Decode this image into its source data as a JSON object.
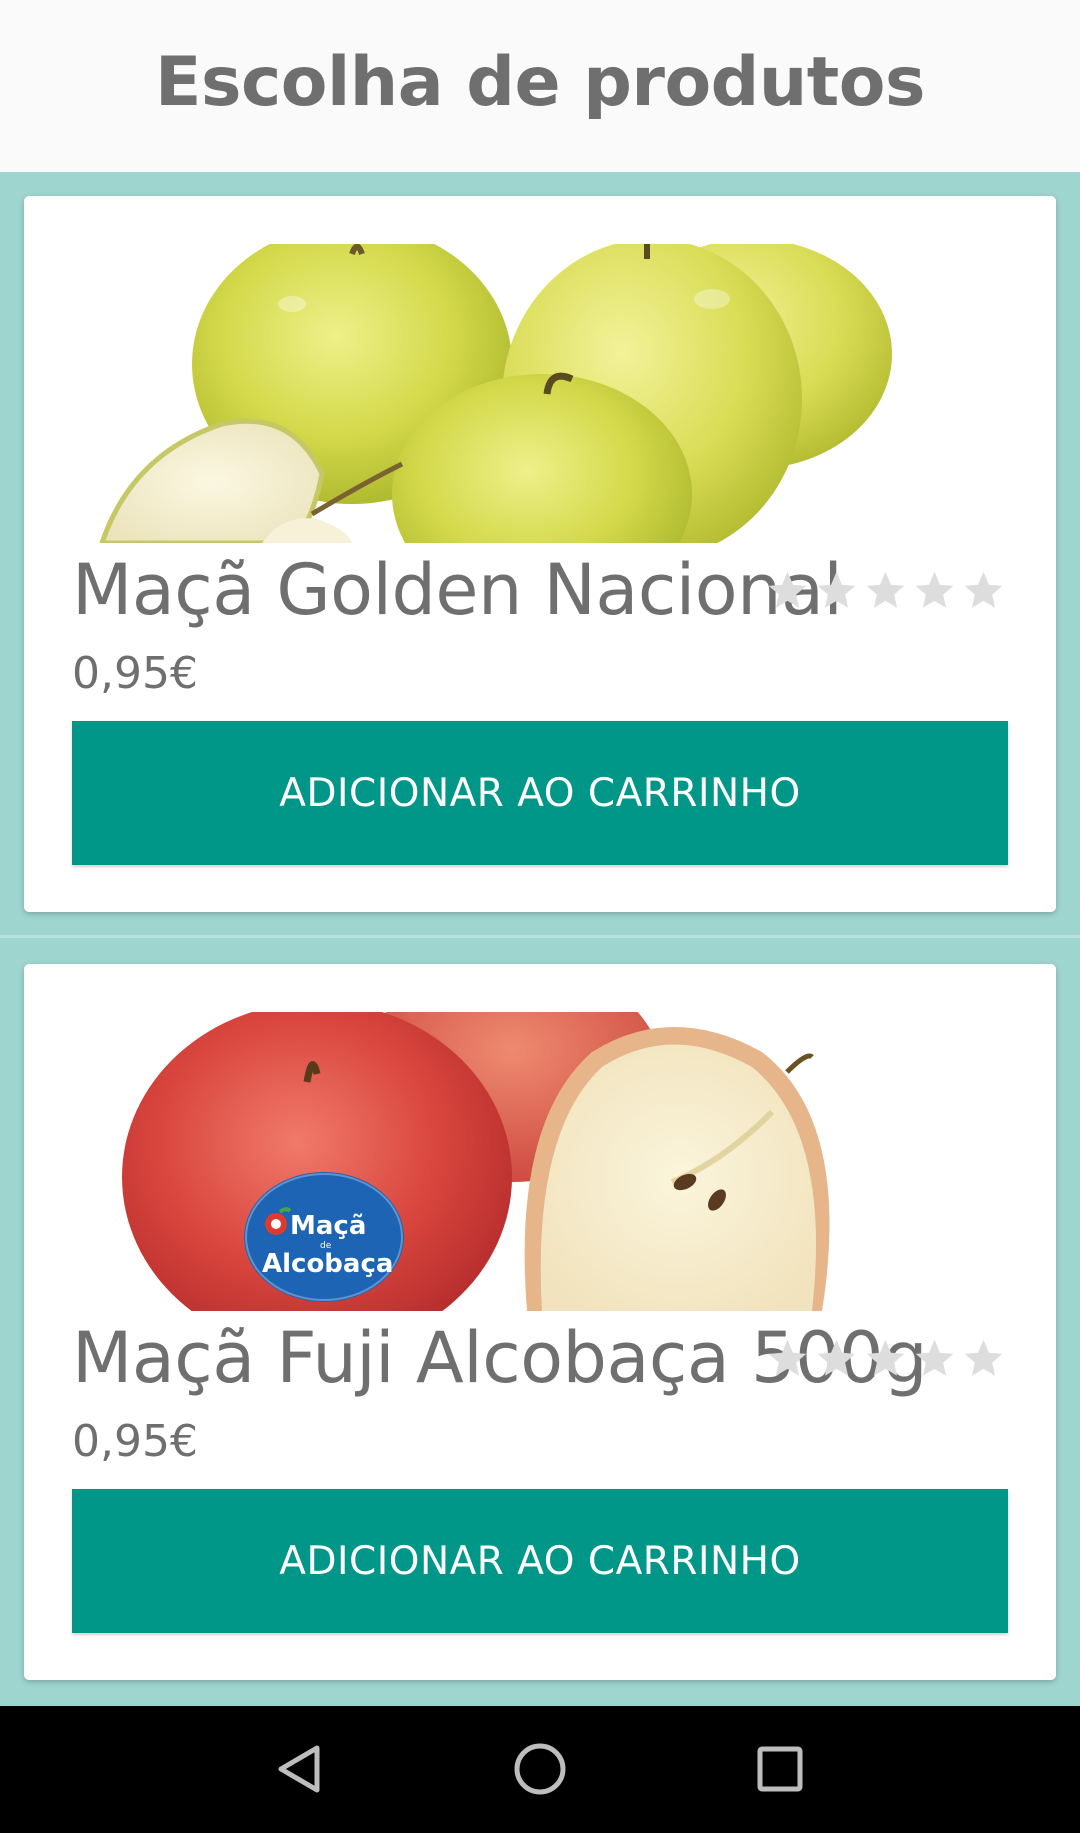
{
  "header": {
    "title": "Escolha de produtos"
  },
  "products": [
    {
      "name": "Maçã Golden Nacional",
      "price": "0,95€",
      "rating": 0,
      "rating_max": 5,
      "image": "golden-apples-photo",
      "button_label": "ADICIONAR AO CARRINHO"
    },
    {
      "name": "Maçã Fuji Alcobaça 500g",
      "price": "0,95€",
      "rating": 0,
      "rating_max": 5,
      "image": "fuji-apples-photo",
      "image_label": "Maçã de Alcobaça",
      "button_label": "ADICIONAR AO CARRINHO"
    }
  ],
  "navbar": {
    "back_icon": "back-triangle-icon",
    "home_icon": "home-circle-icon",
    "recents_icon": "recents-square-icon"
  },
  "colors": {
    "accent": "#009688",
    "list_background": "#9fd5cf",
    "text_gray": "#6f6f6f",
    "star_empty": "#dddddd"
  }
}
